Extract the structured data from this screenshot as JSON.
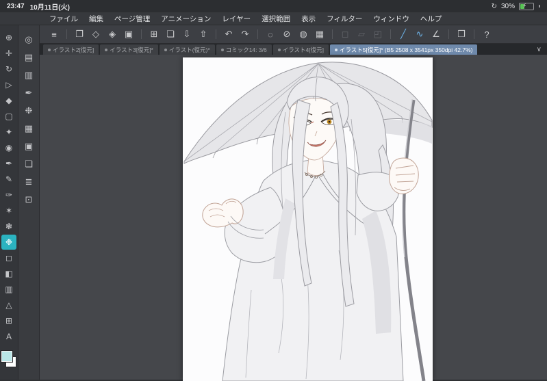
{
  "status_bar": {
    "time": "23:47",
    "date": "10月11日(火)",
    "battery_percent": "30%",
    "icons": [
      "orientation-lock-icon",
      "battery-icon",
      "charging-bolt-icon"
    ]
  },
  "menu_bar": {
    "items": [
      {
        "label": "ファイル"
      },
      {
        "label": "編集"
      },
      {
        "label": "ページ管理"
      },
      {
        "label": "アニメーション"
      },
      {
        "label": "レイヤー"
      },
      {
        "label": "選択範囲"
      },
      {
        "label": "表示"
      },
      {
        "label": "フィルター"
      },
      {
        "label": "ウィンドウ"
      },
      {
        "label": "ヘルプ"
      }
    ]
  },
  "toolbar": {
    "icons": [
      {
        "name": "main-menu-icon",
        "glyph": "≡"
      },
      {
        "divider": true
      },
      {
        "name": "canvas-settings-icon",
        "glyph": "❐"
      },
      {
        "name": "flip-canvas-icon",
        "glyph": "◇"
      },
      {
        "name": "rotate-canvas-icon",
        "glyph": "◈"
      },
      {
        "name": "reference-window-icon",
        "glyph": "▣"
      },
      {
        "divider": true
      },
      {
        "name": "new-canvas-icon",
        "glyph": "⊞"
      },
      {
        "name": "open-file-icon",
        "glyph": "❏"
      },
      {
        "name": "save-icon",
        "glyph": "⇩"
      },
      {
        "name": "export-icon",
        "glyph": "⇧"
      },
      {
        "divider": true
      },
      {
        "name": "undo-icon",
        "glyph": "↶"
      },
      {
        "name": "redo-icon",
        "glyph": "↷"
      },
      {
        "divider": true
      },
      {
        "name": "select-area-icon",
        "glyph": "◌"
      },
      {
        "name": "deselect-icon",
        "glyph": "⊘"
      },
      {
        "name": "invert-selection-icon",
        "glyph": "◍"
      },
      {
        "name": "crop-icon",
        "glyph": "▦"
      },
      {
        "divider": true
      },
      {
        "name": "scale-transform-icon",
        "glyph": "◻",
        "state": "disabled",
        "interactable": false
      },
      {
        "name": "mesh-transform-icon",
        "glyph": "▱",
        "state": "disabled",
        "interactable": false
      },
      {
        "name": "liquify-icon",
        "glyph": "◰",
        "state": "disabled",
        "interactable": false
      },
      {
        "divider": true
      },
      {
        "name": "snap-to-ruler-icon",
        "glyph": "╱",
        "state": "active"
      },
      {
        "name": "snap-to-curve-icon",
        "glyph": "∿",
        "state": "active"
      },
      {
        "name": "measure-icon",
        "glyph": "∠"
      },
      {
        "divider": true
      },
      {
        "name": "panel-layout-icon",
        "glyph": "❒"
      },
      {
        "divider": true
      },
      {
        "name": "help-icon",
        "glyph": "?"
      }
    ]
  },
  "tab_bar": {
    "tabs": [
      {
        "label": "イラスト2[復元]"
      },
      {
        "label": "イラスト3[復元]*"
      },
      {
        "label": "イラスト(復元)*"
      },
      {
        "label": "コミック14: 3/6"
      },
      {
        "label": "イラスト4[復元]"
      },
      {
        "label": "イラスト5[復元]* (B5 2508 x 3541px 350dpi 42.7%)",
        "selected": true
      }
    ],
    "chevron_glyph": "∨"
  },
  "left_toolbar": {
    "tools": [
      {
        "name": "zoom-tool-icon",
        "glyph": "⊕"
      },
      {
        "name": "hand-tool-icon",
        "glyph": "✛"
      },
      {
        "name": "rotate-view-tool-icon",
        "glyph": "↻"
      },
      {
        "name": "operation-tool-icon",
        "glyph": "▷"
      },
      {
        "name": "layer-move-tool-icon",
        "glyph": "◆"
      },
      {
        "name": "selection-tool-icon",
        "glyph": "▢"
      },
      {
        "name": "auto-select-tool-icon",
        "glyph": "✦"
      },
      {
        "name": "eyedropper-tool-icon",
        "glyph": "◉"
      },
      {
        "name": "pen-tool-icon",
        "glyph": "✒"
      },
      {
        "name": "pencil-tool-icon",
        "glyph": "✎"
      },
      {
        "name": "brush-tool-icon",
        "glyph": "✑"
      },
      {
        "name": "airbrush-tool-icon",
        "glyph": "✶"
      },
      {
        "name": "decoration-tool-icon",
        "glyph": "❃"
      },
      {
        "name": "blend-tool-icon",
        "glyph": "❉",
        "selected": true
      },
      {
        "name": "eraser-tool-icon",
        "glyph": "◻"
      },
      {
        "name": "fill-tool-icon",
        "glyph": "◧"
      },
      {
        "name": "gradient-tool-icon",
        "glyph": "▥"
      },
      {
        "name": "figure-tool-icon",
        "glyph": "△"
      },
      {
        "name": "frame-border-tool-icon",
        "glyph": "⊞"
      },
      {
        "name": "text-tool-icon",
        "glyph": "A"
      }
    ],
    "swatches": {
      "primary": "#b9e7e8",
      "secondary": "#ffffff"
    }
  },
  "sub_toolbar": {
    "tools": [
      {
        "name": "quick-access-icon",
        "glyph": "◎"
      },
      {
        "name": "material-icon",
        "glyph": "▤"
      },
      {
        "name": "color-set-icon",
        "glyph": "▥"
      },
      {
        "name": "ink-icon",
        "glyph": "✒"
      },
      {
        "name": "watercolor-icon",
        "glyph": "❉"
      },
      {
        "name": "palette-icon",
        "glyph": "▦"
      },
      {
        "name": "settings-store-icon",
        "glyph": "▣"
      },
      {
        "name": "shapes-icon",
        "glyph": "❏"
      },
      {
        "name": "layers-icon",
        "glyph": "≣"
      },
      {
        "name": "timeline-icon",
        "glyph": "⊡"
      }
    ]
  },
  "colors": {
    "workspace_bg": "#45474b",
    "selected_tab": "#6e89ab",
    "selected_tool": "#2bb3c0",
    "active_icon": "#6db3e8",
    "battery_green": "#57c554"
  }
}
